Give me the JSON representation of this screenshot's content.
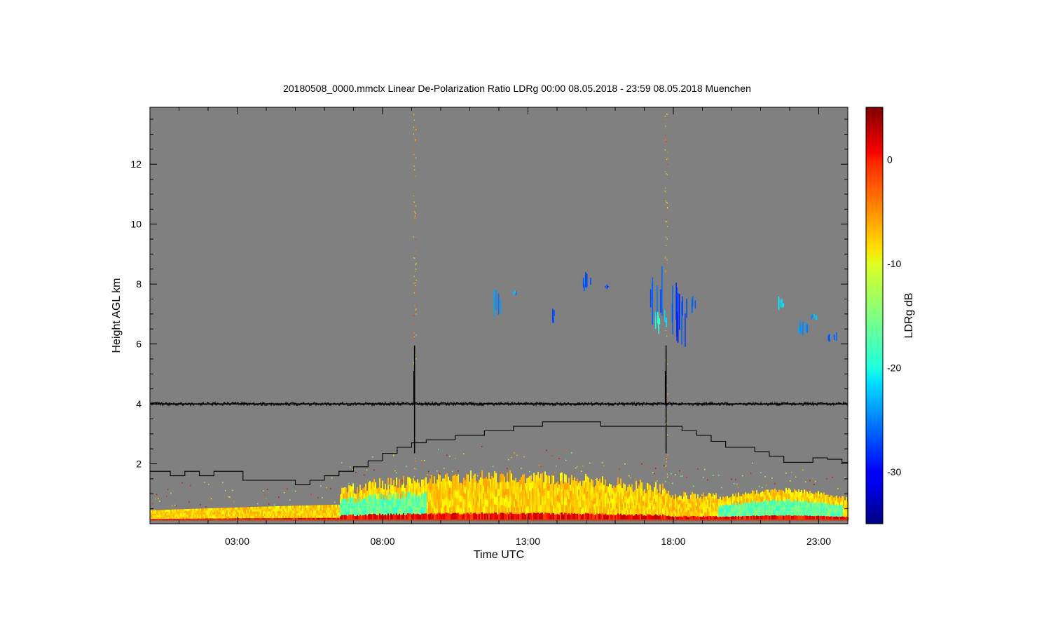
{
  "chart_data": {
    "type": "heatmap",
    "title": "20180508_0000.mmclx Linear De-Polarization Ratio LDRg   00:00 08.05.2018 - 23:59 08.05.2018 Muenchen",
    "xlabel": "Time UTC",
    "ylabel": "Height AGL km",
    "x_ticks": [
      "03:00",
      "08:00",
      "13:00",
      "18:00",
      "23:00"
    ],
    "x_tick_hours": [
      3,
      8,
      13,
      18,
      23
    ],
    "xlim_hours": [
      0,
      24
    ],
    "y_ticks": [
      "2",
      "4",
      "6",
      "8",
      "10",
      "12"
    ],
    "y_tick_values": [
      2,
      4,
      6,
      8,
      10,
      12
    ],
    "ylim_km": [
      0,
      13.9
    ],
    "background_color": "#808080",
    "colorbar": {
      "label": "LDRg dB",
      "ticks": [
        "0",
        "-10",
        "-20",
        "-30"
      ],
      "tick_values": [
        0,
        -10,
        -20,
        -30
      ],
      "range": [
        -35,
        5
      ],
      "colormap": "jet"
    },
    "boundary_layer_height_km": {
      "hours": [
        0,
        0.7,
        1.2,
        1.7,
        2.2,
        3.2,
        5.0,
        5.5,
        6.0,
        6.5,
        7.0,
        7.5,
        8.0,
        8.5,
        9.0,
        9.5,
        10.5,
        11.5,
        12.5,
        13.5,
        14.8,
        15.5,
        17.3,
        17.8,
        18.3,
        18.8,
        19.3,
        19.8,
        20.8,
        21.3,
        21.8,
        22.8,
        23.3,
        23.8,
        24
      ],
      "values": [
        1.75,
        1.6,
        1.75,
        1.6,
        1.75,
        1.45,
        1.3,
        1.45,
        1.6,
        1.75,
        1.9,
        2.1,
        2.35,
        2.55,
        2.7,
        2.8,
        2.95,
        3.1,
        3.25,
        3.4,
        3.4,
        3.25,
        3.25,
        3.25,
        3.1,
        2.95,
        2.75,
        2.55,
        2.4,
        2.25,
        2.05,
        2.2,
        2.15,
        2.05,
        1.95
      ]
    },
    "reference_line_km": 4.0,
    "spike_hours": [
      9.1,
      17.75
    ],
    "cloud_patches": [
      {
        "t0": 11.8,
        "t1": 12.05,
        "h0": 6.6,
        "h1": 7.9,
        "ldr": -25
      },
      {
        "t0": 12.45,
        "t1": 12.6,
        "h0": 7.6,
        "h1": 7.8,
        "ldr": -24
      },
      {
        "t0": 13.7,
        "t1": 13.9,
        "h0": 6.7,
        "h1": 7.2,
        "ldr": -26
      },
      {
        "t0": 14.85,
        "t1": 15.25,
        "h0": 7.7,
        "h1": 8.4,
        "ldr": -26
      },
      {
        "t0": 15.6,
        "t1": 15.75,
        "h0": 7.8,
        "h1": 8.0,
        "ldr": -27
      },
      {
        "t0": 17.2,
        "t1": 17.6,
        "h0": 6.6,
        "h1": 8.6,
        "ldr": -27
      },
      {
        "t0": 17.35,
        "t1": 17.75,
        "h0": 6.3,
        "h1": 7.2,
        "ldr": -20
      },
      {
        "t0": 17.9,
        "t1": 18.5,
        "h0": 5.9,
        "h1": 8.3,
        "ldr": -28
      },
      {
        "t0": 18.6,
        "t1": 18.8,
        "h0": 7.0,
        "h1": 7.6,
        "ldr": -26
      },
      {
        "t0": 21.6,
        "t1": 21.8,
        "h0": 7.1,
        "h1": 7.6,
        "ldr": -20
      },
      {
        "t0": 22.2,
        "t1": 22.6,
        "h0": 6.3,
        "h1": 6.8,
        "ldr": -24
      },
      {
        "t0": 22.7,
        "t1": 22.95,
        "h0": 6.8,
        "h1": 7.1,
        "ldr": -23
      },
      {
        "t0": 23.3,
        "t1": 23.6,
        "h0": 6.0,
        "h1": 6.4,
        "ldr": -25
      }
    ]
  }
}
